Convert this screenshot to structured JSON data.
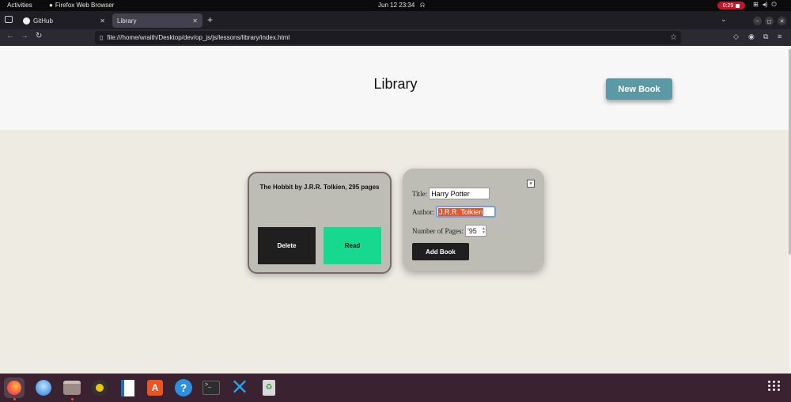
{
  "system": {
    "activities": "Activities",
    "app_name": "Firefox Web Browser",
    "clock": "Jun 12  23:34",
    "recording": "0:29"
  },
  "tabs": [
    {
      "label": "GitHub"
    },
    {
      "label": "Library"
    }
  ],
  "url": "file:///home/wraith/Desktop/dev/op_js/js/lessons/library/index.html",
  "page": {
    "title": "Library",
    "new_book_label": "New Book",
    "book_card": {
      "info": "The Hobbit by J.R.R. Tolkien, 295 pages",
      "delete_label": "Delete",
      "read_label": "Read"
    },
    "form": {
      "close_label": "×",
      "title_label": "Title:",
      "title_value": "Harry Potter",
      "author_label": "Author:",
      "author_value": "J.R.R. Tolkien",
      "pages_label": "Number of Pages:",
      "pages_value": "'95",
      "add_label": "Add Book"
    }
  },
  "colors": {
    "new_book": "#5b9aa4",
    "read": "#17d88f",
    "delete": "#1f1f1f",
    "selection": "#e6552b"
  },
  "dock": [
    "firefox-icon",
    "thunderbird-icon",
    "files-icon",
    "rhythmbox-icon",
    "writer-icon",
    "app-center-icon",
    "help-icon",
    "terminal-icon",
    "vscode-icon",
    "trash-icon"
  ]
}
